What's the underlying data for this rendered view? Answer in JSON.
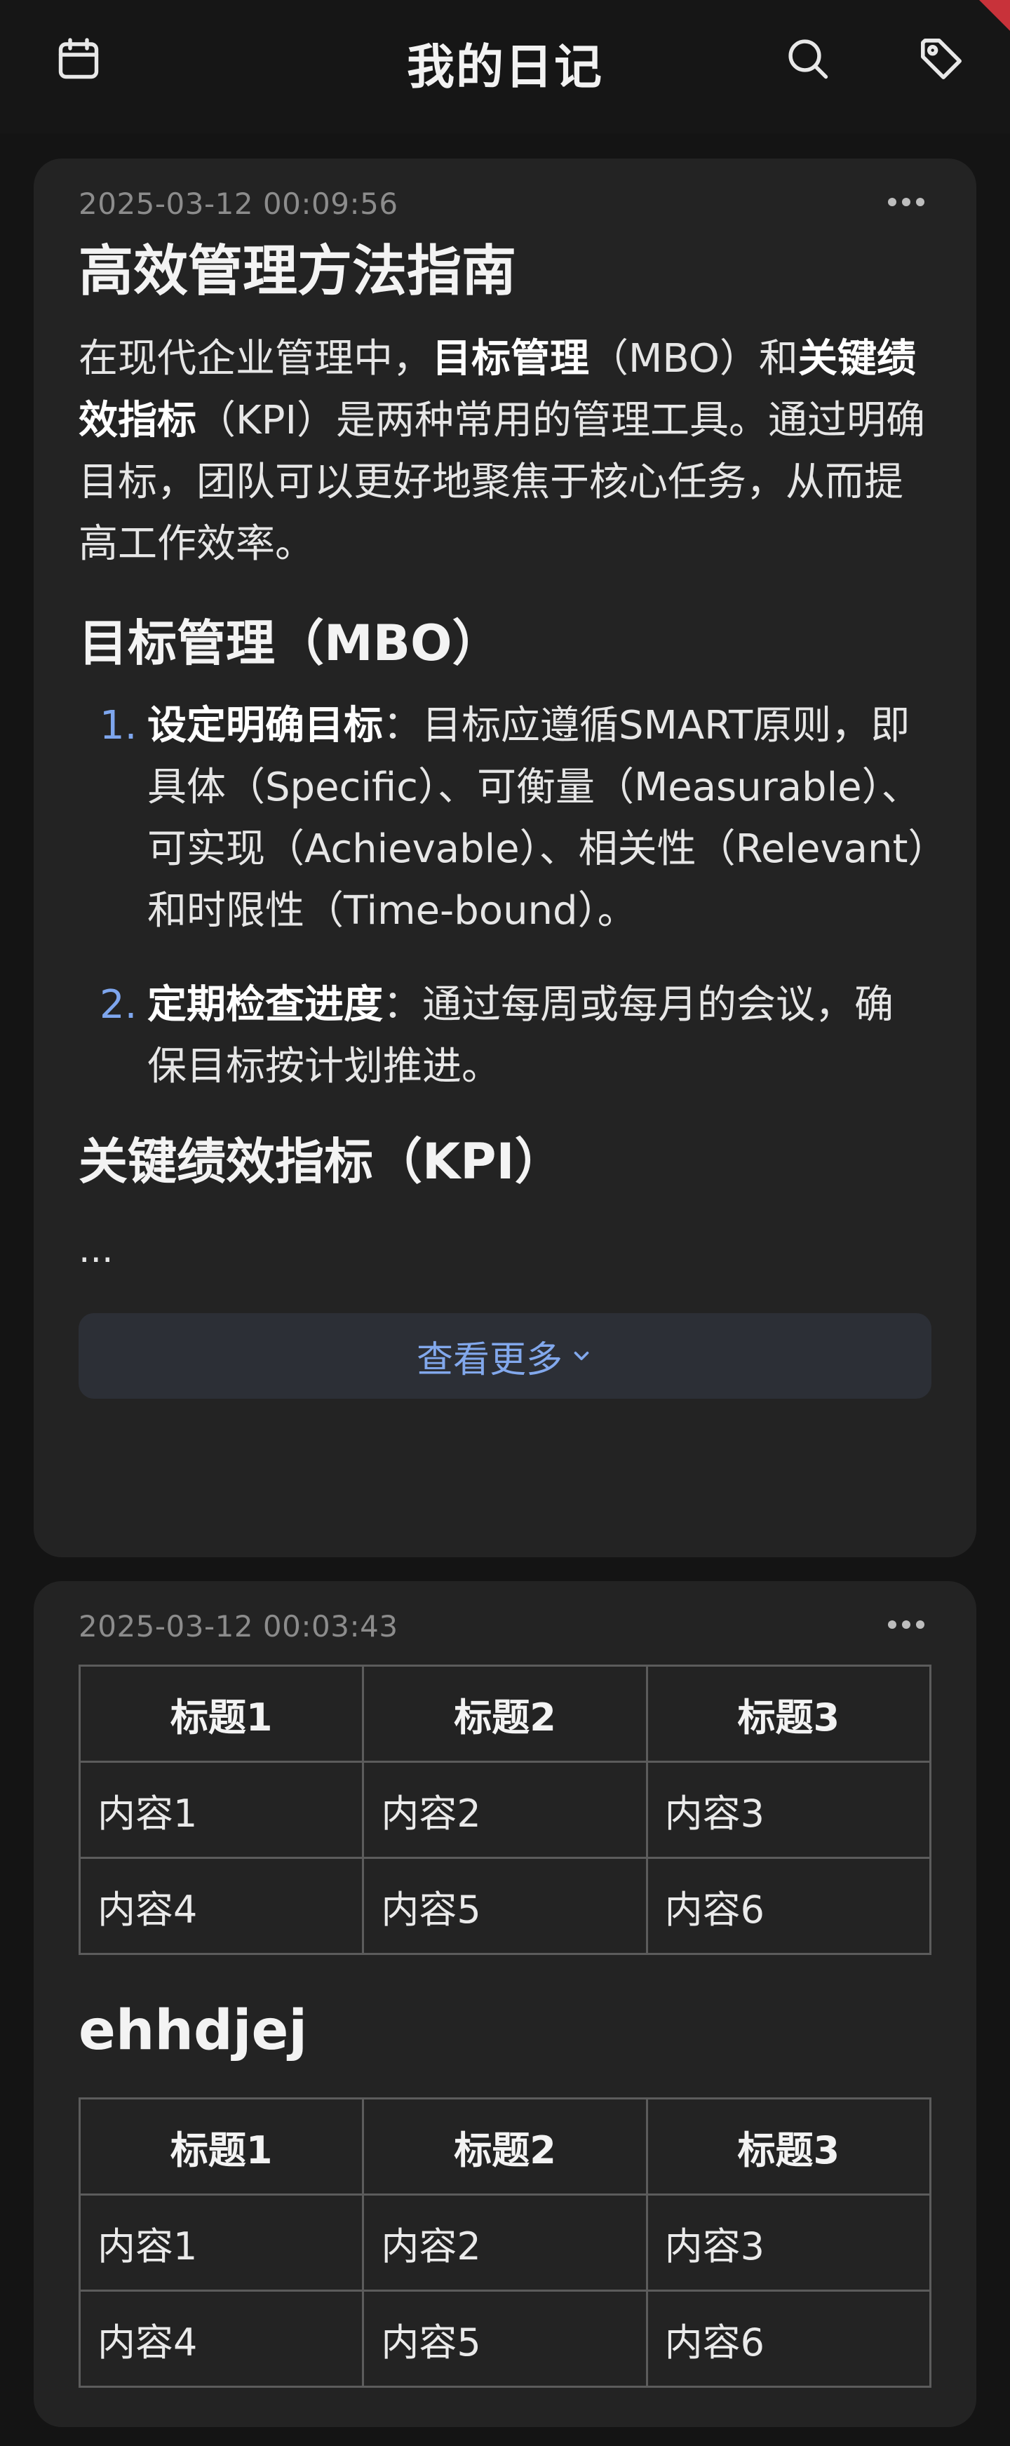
{
  "header": {
    "title": "我的日记",
    "left_icon": "calendar-icon",
    "right_icons": [
      "search-icon",
      "tag-icon"
    ]
  },
  "entries": [
    {
      "timestamp": "2025-03-12 00:09:56",
      "title": "高效管理方法指南",
      "intro": {
        "t1": "在现代企业管理中，",
        "b1": "目标管理",
        "t2": "（MBO）和",
        "b2": "关键绩效指标",
        "t3": "（KPI）是两种常用的管理工具。通过明确目标，团队可以更好地聚焦于核心任务，从而提高工作效率。"
      },
      "section1_title": "目标管理（MBO）",
      "list": [
        {
          "num": "1.",
          "bold": "设定明确目标",
          "text": "：目标应遵循SMART原则，即具体（Specific）、可衡量（Measurable）、可实现（Achievable）、相关性（Relevant）和时限性（Time-bound）。"
        },
        {
          "num": "2.",
          "bold": "定期检查进度",
          "text": "：通过每周或每月的会议，确保目标按计划推进。"
        }
      ],
      "section2_title": "关键绩效指标（KPI）",
      "ellipsis": "...",
      "view_more_label": "查看更多"
    },
    {
      "timestamp": "2025-03-12 00:03:43",
      "table1": {
        "headers": [
          "标题1",
          "标题2",
          "标题3"
        ],
        "rows": [
          [
            "内容1",
            "内容2",
            "内容3"
          ],
          [
            "内容4",
            "内容5",
            "内容6"
          ]
        ]
      },
      "heading": "ehhdjej",
      "table2": {
        "headers": [
          "标题1",
          "标题2",
          "标题3"
        ],
        "rows": [
          [
            "内容1",
            "内容2",
            "内容3"
          ],
          [
            "内容4",
            "内容5",
            "内容6"
          ]
        ]
      }
    }
  ],
  "colors": {
    "background": "#141414",
    "card": "#232323",
    "accent": "#7ea6ee",
    "ribbon": "#c8323a"
  }
}
